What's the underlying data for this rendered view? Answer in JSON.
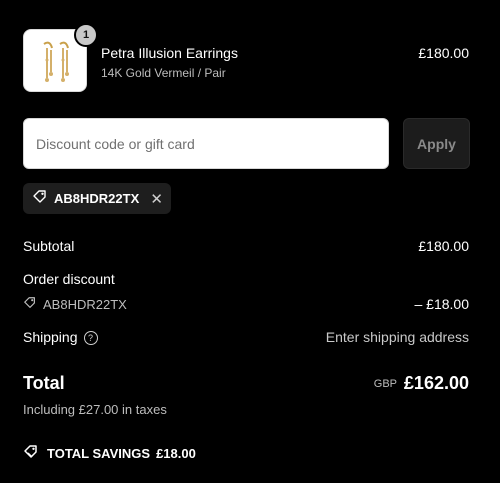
{
  "product": {
    "quantity": "1",
    "name": "Petra Illusion Earrings",
    "variant": "14K Gold Vermeil / Pair",
    "price": "£180.00",
    "image_icon": "earrings-image"
  },
  "discount": {
    "placeholder": "Discount code or gift card",
    "apply_label": "Apply",
    "applied_code": "AB8HDR22TX"
  },
  "summary": {
    "subtotal_label": "Subtotal",
    "subtotal_value": "£180.00",
    "order_discount_label": "Order discount",
    "discount_code": "AB8HDR22TX",
    "discount_value": "– £18.00",
    "shipping_label": "Shipping",
    "shipping_value": "Enter shipping address",
    "total_label": "Total",
    "currency": "GBP",
    "total_value": "£162.00",
    "tax_note": "Including £27.00 in taxes",
    "savings_label": "TOTAL SAVINGS",
    "savings_value": "£18.00"
  },
  "colors": {
    "background": "#000000",
    "text": "#ffffff",
    "muted": "#bdbdbd",
    "chip": "#1e1e1e",
    "apply_button": "#1c1c1c"
  }
}
